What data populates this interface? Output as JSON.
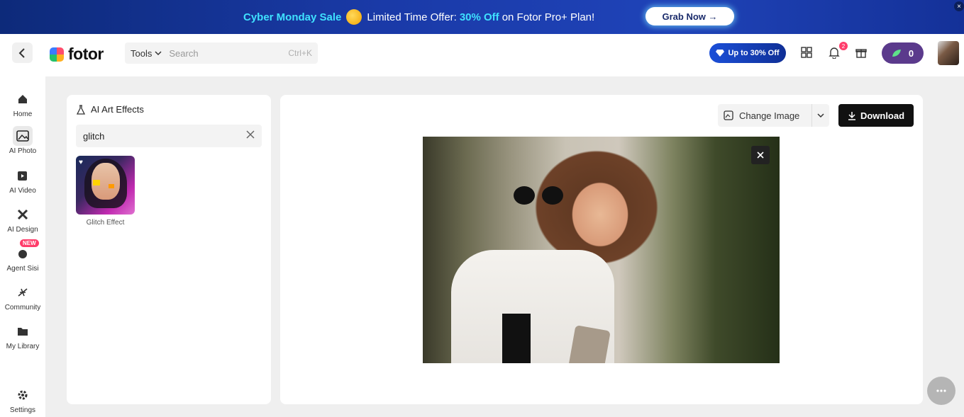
{
  "banner": {
    "sale_label": "Cyber Monday Sale",
    "offer_prefix": "Limited Time Offer:",
    "offer_percent": "30% Off",
    "offer_suffix": "on Fotor Pro+ Plan!",
    "cta_label": "Grab Now →",
    "close_glyph": "×"
  },
  "topbar": {
    "logo_text": "fotor",
    "tools_label": "Tools",
    "search_placeholder": "Search",
    "search_shortcut": "Ctrl+K",
    "promo_label": "Up to 30% Off",
    "notification_count": "2",
    "credits_count": "0"
  },
  "nav": {
    "items": [
      {
        "label": "Home",
        "icon": "home-icon"
      },
      {
        "label": "AI Photo",
        "icon": "ai-photo-icon"
      },
      {
        "label": "AI Video",
        "icon": "ai-video-icon"
      },
      {
        "label": "AI Design",
        "icon": "ai-design-icon"
      },
      {
        "label": "Agent Sisi",
        "icon": "agent-icon",
        "badge": "NEW"
      },
      {
        "label": "Community",
        "icon": "community-icon"
      },
      {
        "label": "My Library",
        "icon": "folder-icon"
      },
      {
        "label": "Settings",
        "icon": "gear-icon"
      }
    ],
    "active": "AI Photo"
  },
  "panel": {
    "title": "AI Art Effects",
    "search_value": "glitch",
    "effects": [
      {
        "label": "Glitch Effect"
      }
    ]
  },
  "canvas": {
    "change_image_label": "Change Image",
    "download_label": "Download"
  },
  "colors": {
    "banner_bg": "#1a3aa8",
    "accent_cyan": "#3fe1ff",
    "download_bg": "#111111",
    "credits_bg": "#5b3a8c",
    "badge_pink": "#ff3d6b"
  }
}
